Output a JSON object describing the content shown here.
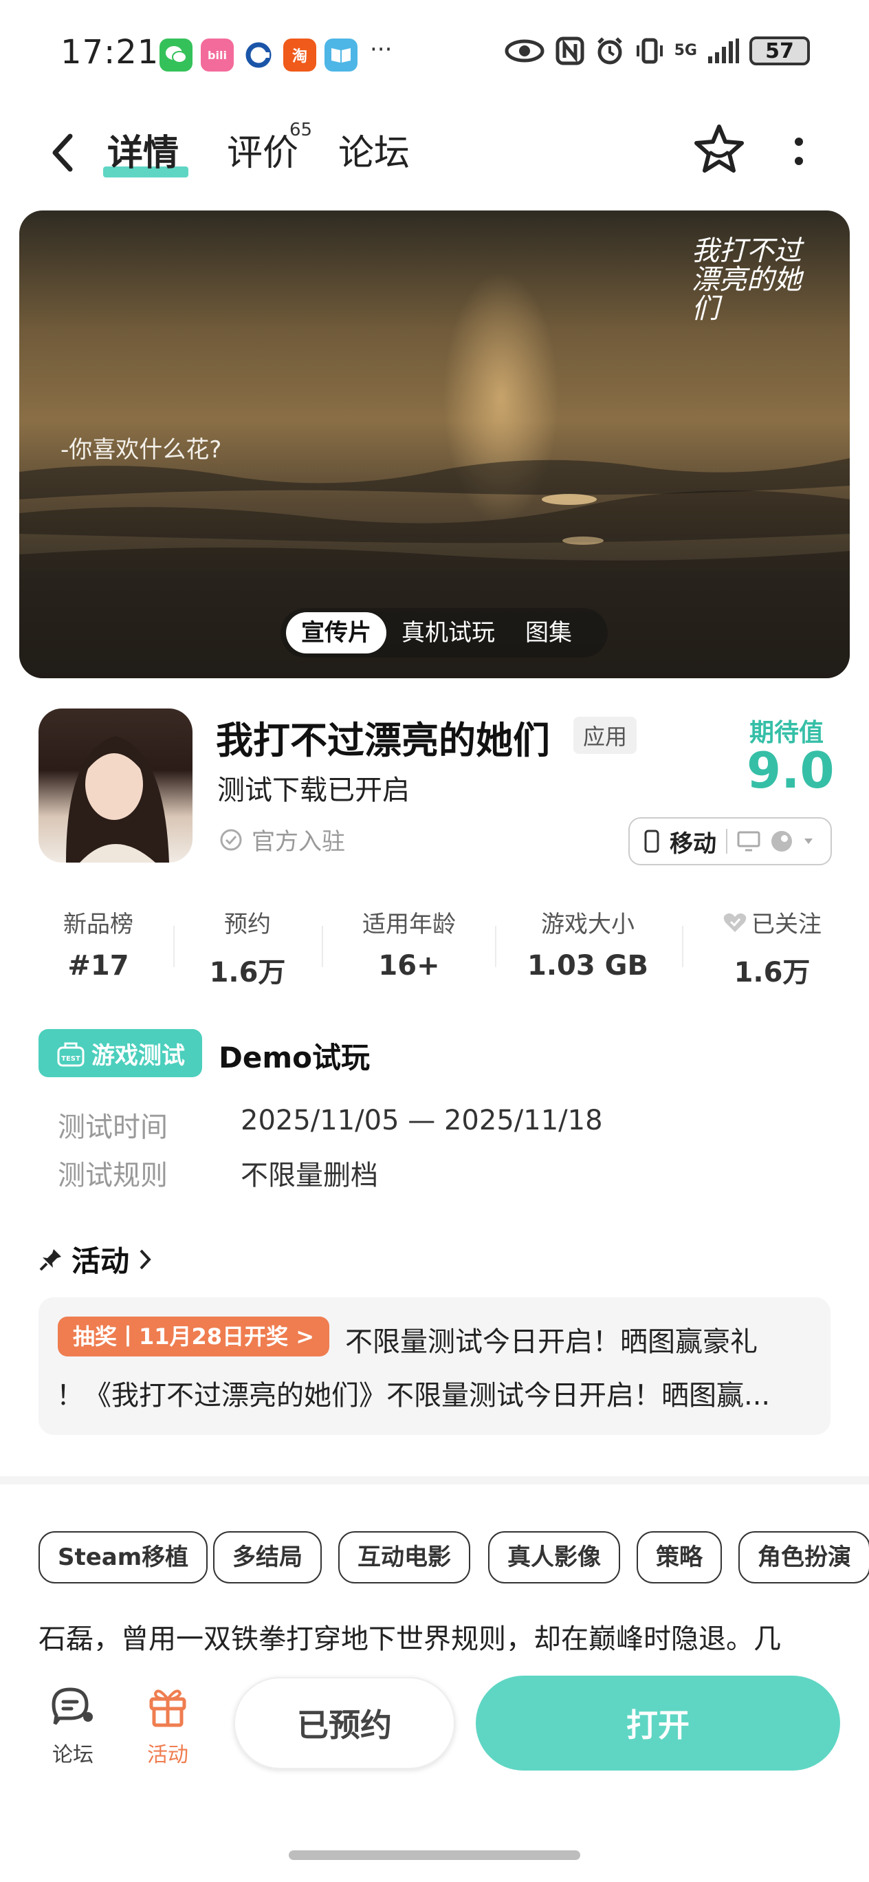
{
  "status_bar": {
    "time": "17:21",
    "ellipsis": "···",
    "network": "5G",
    "battery": "57",
    "app_icons": [
      "wechat-icon",
      "bilibili-icon",
      "bank-icon",
      "taobao-icon",
      "reader-icon"
    ]
  },
  "nav": {
    "tabs": [
      {
        "label": "详情",
        "active": true
      },
      {
        "label": "评价",
        "badge": "65"
      },
      {
        "label": "论坛"
      }
    ]
  },
  "media": {
    "caption": "-你喜欢什么花?",
    "logo_text": "我打不过漂亮的她们",
    "tabs": [
      {
        "label": "宣传片",
        "active": true
      },
      {
        "label": "真机试玩"
      },
      {
        "label": "图集"
      }
    ]
  },
  "app": {
    "title": "我打不过漂亮的她们",
    "tag": "应用",
    "subtitle": "测试下载已开启",
    "official": "官方入驻",
    "expect_label": "期待值",
    "expect_value": "9.0",
    "platform_label": "移动"
  },
  "stats": [
    {
      "label": "新品榜",
      "value": "#17"
    },
    {
      "label": "预约",
      "value": "1.6万"
    },
    {
      "label": "适用年龄",
      "value": "16+"
    },
    {
      "label": "游戏大小",
      "value": "1.03 GB"
    },
    {
      "label": "已关注",
      "value": "1.6万"
    }
  ],
  "test": {
    "badge": "游戏测试",
    "badge_small": "TEST",
    "title": "Demo试玩",
    "rows": [
      {
        "label": "测试时间",
        "value": "2025/11/05 — 2025/11/18"
      },
      {
        "label": "测试规则",
        "value": "不限量删档"
      }
    ]
  },
  "activity": {
    "title": "活动",
    "badge": "抽奖丨11月28日开奖 >",
    "line1": "不限量测试今日开启！晒图赢豪礼",
    "line2": "！《我打不过漂亮的她们》不限量测试今日开启！晒图赢..."
  },
  "tags": [
    "Steam移植",
    "多结局",
    "互动电影",
    "真人影像",
    "策略",
    "角色扮演"
  ],
  "description": "石磊，曾用一双铁拳打穿地下世界规则，却在巅峰时隐退。几",
  "bottom": {
    "forum_label": "论坛",
    "activity_label": "活动",
    "reserved_label": "已预约",
    "open_label": "打开"
  },
  "colors": {
    "accent": "#5fd6c4",
    "accent_text": "#36bfa7",
    "activity_orange": "#ef7d50"
  }
}
